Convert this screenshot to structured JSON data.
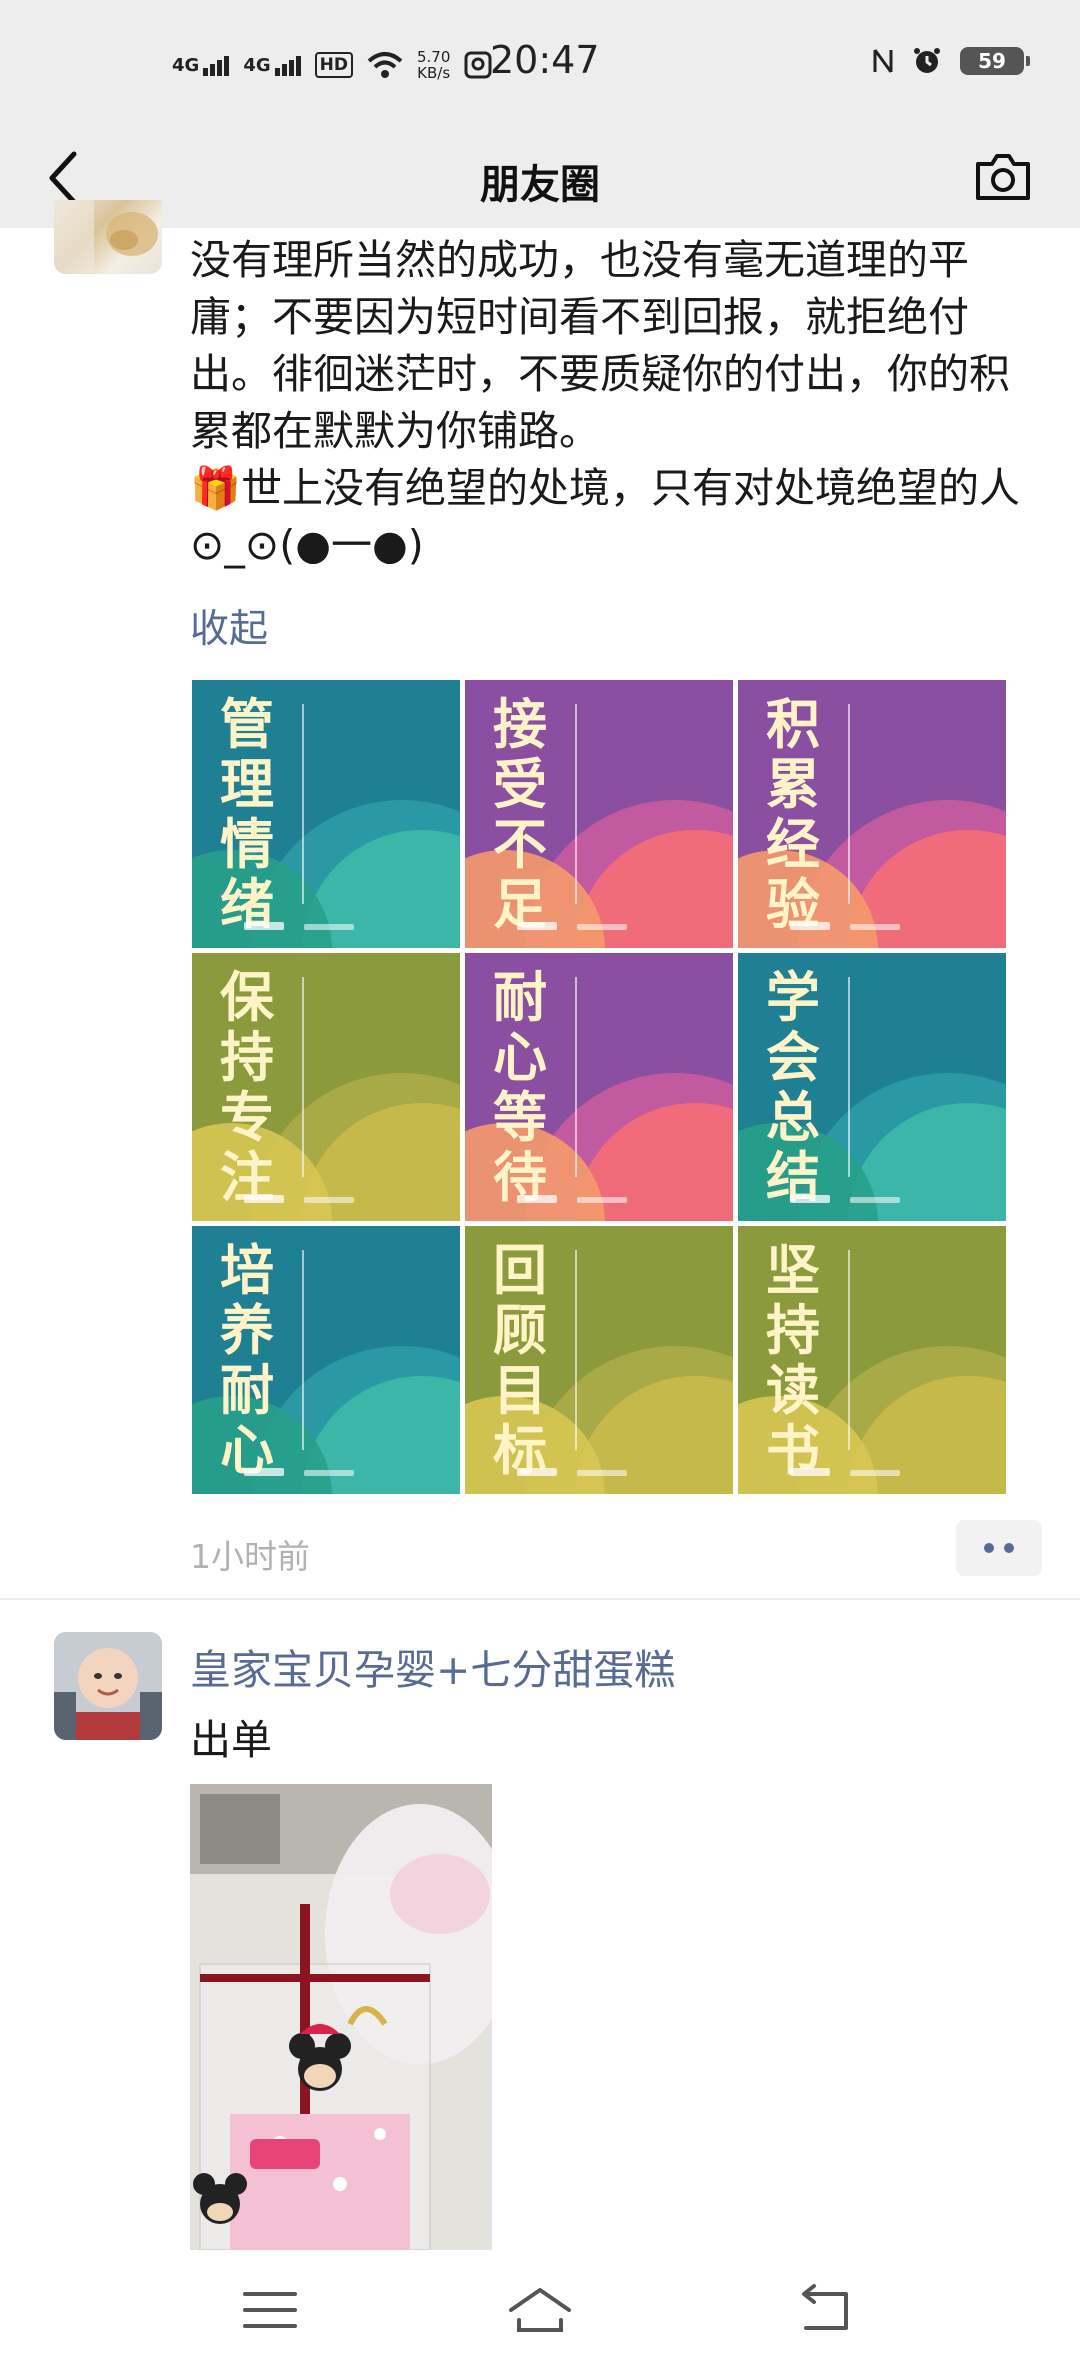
{
  "status_bar": {
    "network1": "4G",
    "network2": "4G",
    "hd_badge": "HD",
    "speed_value": "5.70",
    "speed_unit": "KB/s",
    "time": "20:47",
    "battery": "59"
  },
  "nav": {
    "title": "朋友圈",
    "back_icon": "chevron-left-icon",
    "camera_icon": "camera-icon"
  },
  "post1": {
    "paragraphs": [
      "没有理所当然的成功，也没有毫无道理的平庸；不要因为短时间看不到回报，就拒绝付出。徘徊迷茫时，不要质疑你的付出，你的积累都在默默为你铺路。"
    ],
    "gift_emoji": "🎁",
    "last_line": "世上没有绝望的处境，只有对处境绝望的人⊙_⊙(●一●)",
    "collapse_label": "收起",
    "images": [
      {
        "title": "管理情绪",
        "bg": "#1f7f93",
        "c1": "#2a98a5",
        "c2": "#3cb6a9",
        "c3": "#27a08b"
      },
      {
        "title": "接受不足",
        "bg": "#8a4fa0",
        "c1": "#c25aa0",
        "c2": "#f06c7a",
        "c3": "#f59a6c"
      },
      {
        "title": "积累经验",
        "bg": "#8a4fa0",
        "c1": "#c25aa0",
        "c2": "#f06c7a",
        "c3": "#f59a6c"
      },
      {
        "title": "保持专注",
        "bg": "#8b9a3c",
        "c1": "#a8aa48",
        "c2": "#c6b94c",
        "c3": "#d7c653"
      },
      {
        "title": "耐心等待",
        "bg": "#8a4fa0",
        "c1": "#c25aa0",
        "c2": "#f06c7a",
        "c3": "#f59a6c"
      },
      {
        "title": "学会总结",
        "bg": "#1f7f93",
        "c1": "#2a98a5",
        "c2": "#3cb6a9",
        "c3": "#27a08b"
      },
      {
        "title": "培养耐心",
        "bg": "#1f7f93",
        "c1": "#2a98a5",
        "c2": "#3cb6a9",
        "c3": "#27a08b"
      },
      {
        "title": "回顾目标",
        "bg": "#8b9a3c",
        "c1": "#a8aa48",
        "c2": "#c6b94c",
        "c3": "#d7c653"
      },
      {
        "title": "坚持读书",
        "bg": "#8b9a3c",
        "c1": "#a8aa48",
        "c2": "#c6b94c",
        "c3": "#d7c653"
      }
    ],
    "time": "1小时前"
  },
  "post2": {
    "author": "皇家宝贝孕婴+七分甜蛋糕",
    "text": "出单"
  },
  "bottom_nav": {
    "menu_icon": "menu-icon",
    "home_icon": "home-icon",
    "back_icon": "return-icon"
  },
  "colors": {
    "link": "#576b95",
    "bar_bg": "#ededed"
  }
}
